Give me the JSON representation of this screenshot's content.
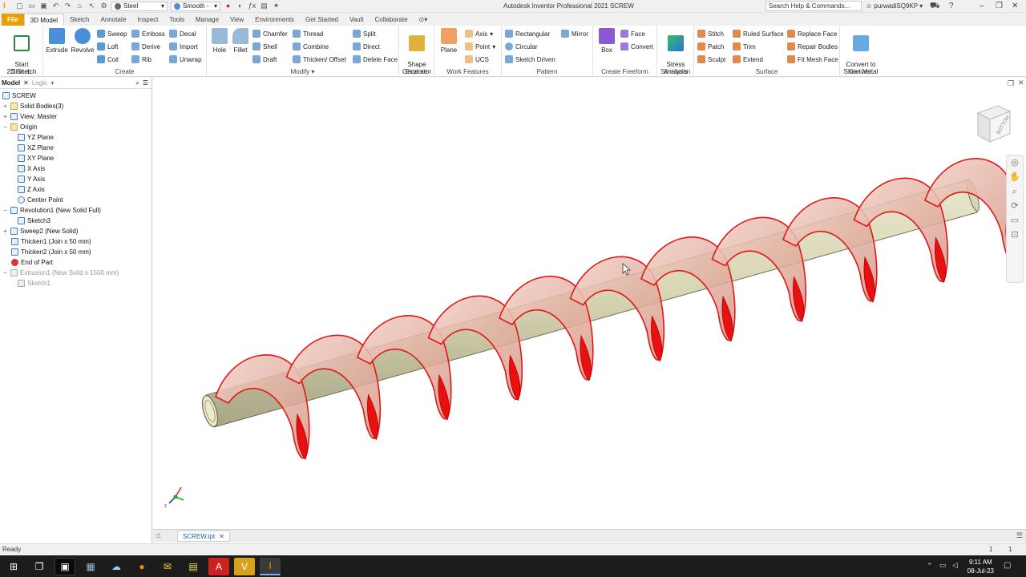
{
  "app": {
    "title": "Autodesk Inventor Professional 2021   SCREW",
    "material": "Steel",
    "appearance": "Smooth -",
    "search_placeholder": "Search Help & Commands...",
    "user": "purwadiSQ9KP"
  },
  "menu": [
    "File",
    "3D Model",
    "Sketch",
    "Annotate",
    "Inspect",
    "Tools",
    "Manage",
    "View",
    "Environments",
    "Get Started",
    "Vault",
    "Collaborate"
  ],
  "ribbon": {
    "sketch": {
      "label": "Sketch",
      "start": "Start\n2D Sketch"
    },
    "create": {
      "label": "Create",
      "extrude": "Extrude",
      "revolve": "Revolve",
      "sweep": "Sweep",
      "loft": "Loft",
      "coil": "Coil",
      "emboss": "Emboss",
      "derive": "Derive",
      "rib": "Rib",
      "decal": "Decal",
      "import": "Import",
      "unwrap": "Unwrap"
    },
    "modify": {
      "label": "Modify",
      "hole": "Hole",
      "fillet": "Fillet",
      "chamfer": "Chamfer",
      "shell": "Shell",
      "draft": "Draft",
      "thread": "Thread",
      "combine": "Combine",
      "thicken": "Thicken/ Offset",
      "split": "Split",
      "direct": "Direct",
      "delete_face": "Delete Face"
    },
    "explore": {
      "label": "Explore",
      "shape_gen": "Shape\nGenerator"
    },
    "work": {
      "label": "Work Features",
      "plane": "Plane",
      "axis": "Axis",
      "point": "Point",
      "ucs": "UCS"
    },
    "pattern": {
      "label": "Pattern",
      "rectangular": "Rectangular",
      "circular": "Circular",
      "sketch_driven": "Sketch Driven",
      "mirror": "Mirror"
    },
    "freeform": {
      "label": "Create Freeform",
      "box": "Box",
      "face": "Face",
      "convert": "Convert"
    },
    "simulation": {
      "label": "Simulation",
      "stress": "Stress\nAnalysis"
    },
    "surface": {
      "label": "Surface",
      "stitch": "Stitch",
      "patch": "Patch",
      "sculpt": "Sculpt",
      "ruled": "Ruled Surface",
      "trim": "Trim",
      "extend": "Extend",
      "replace": "Replace Face",
      "repair": "Repair Bodies",
      "fitmesh": "Fit Mesh Face"
    },
    "convert": {
      "label": "Convert",
      "sheet": "Convert to\nSheet Metal"
    }
  },
  "browser": {
    "tabs": [
      "Model",
      "Logic"
    ],
    "items": [
      {
        "label": "SCREW"
      },
      {
        "label": "Solid Bodies(3)"
      },
      {
        "label": "View: Master"
      },
      {
        "label": "Origin"
      },
      {
        "label": "YZ Plane"
      },
      {
        "label": "XZ Plane"
      },
      {
        "label": "XY Plane"
      },
      {
        "label": "X Axis"
      },
      {
        "label": "Y Axis"
      },
      {
        "label": "Z Axis"
      },
      {
        "label": "Center Point"
      },
      {
        "label": "Revolution1 (New Solid Full)"
      },
      {
        "label": "Sketch3"
      },
      {
        "label": "Sweep2 (New Solid)"
      },
      {
        "label": "Thicken1 (Join x 50 mm)"
      },
      {
        "label": "Thicken2 (Join x 50 mm)"
      },
      {
        "label": "End of Part"
      },
      {
        "label": "Extrusion1 (New Solid x 1500 mm)"
      },
      {
        "label": "Sketch1"
      }
    ]
  },
  "viewcube_label": "BOTTOM",
  "document_tab": "SCREW.ipt",
  "status": {
    "text": "Ready",
    "count1": "1",
    "count2": "1"
  },
  "taskbar": {
    "time": "9:11 AM",
    "date": "08-Jul-23"
  }
}
